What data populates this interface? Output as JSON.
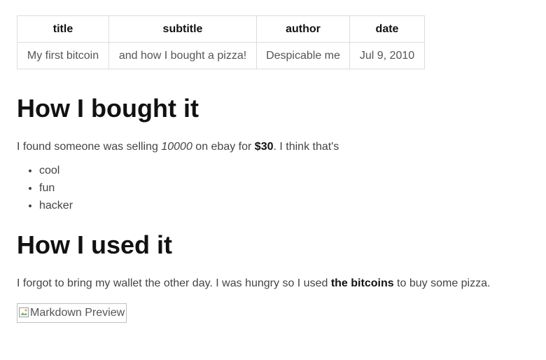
{
  "meta_table": {
    "headers": [
      "title",
      "subtitle",
      "author",
      "date"
    ],
    "row": [
      "My first bitcoin",
      "and how I bought a pizza!",
      "Despicable me",
      "Jul 9, 2010"
    ]
  },
  "section1": {
    "heading": "How I bought it",
    "para": {
      "t1": "I found someone was selling ",
      "em": "10000",
      "t2": " on ebay for ",
      "strong": "$30",
      "t3": ". I think that's"
    },
    "list": [
      "cool",
      "fun",
      "hacker"
    ]
  },
  "section2": {
    "heading": "How I used it",
    "para": {
      "t1": "I forgot to bring my wallet the other day. I was hungry so I used ",
      "strong": "the bitcoins",
      "t2": " to buy some pizza."
    }
  },
  "image": {
    "alt": "Markdown Preview",
    "icon": "broken-image-icon"
  }
}
